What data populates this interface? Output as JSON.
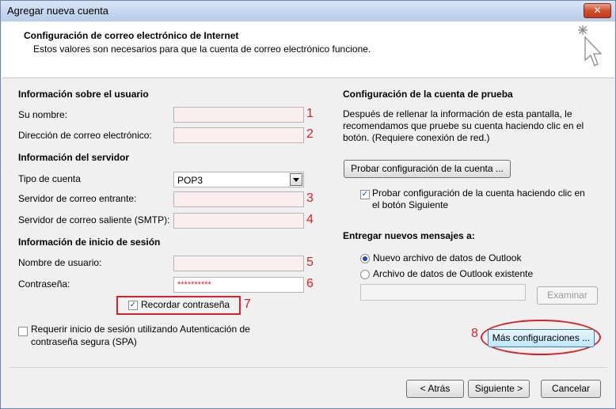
{
  "window": {
    "title": "Agregar nueva cuenta",
    "close_symbol": "✕"
  },
  "header": {
    "title": "Configuración de correo electrónico de Internet",
    "subtitle": "Estos valores son necesarios para que la cuenta de correo electrónico funcione.",
    "icon": "cursor-sparkle-icon"
  },
  "user_info": {
    "section": "Información sobre el usuario",
    "name_label": "Su nombre:",
    "name_value": "",
    "name_marker": "1",
    "email_label": "Dirección de correo electrónico:",
    "email_value": "",
    "email_marker": "2"
  },
  "server_info": {
    "section": "Información del servidor",
    "account_type_label": "Tipo de cuenta",
    "account_type_value": "POP3",
    "incoming_label": "Servidor de correo entrante:",
    "incoming_value": "",
    "incoming_marker": "3",
    "outgoing_label": "Servidor de correo saliente (SMTP):",
    "outgoing_value": "",
    "outgoing_marker": "4"
  },
  "login_info": {
    "section": "Información de inicio de sesión",
    "username_label": "Nombre de usuario:",
    "username_value": "",
    "username_marker": "5",
    "password_label": "Contraseña:",
    "password_value": "**********",
    "password_marker": "6",
    "remember_label": "Recordar contraseña",
    "remember_checked": true,
    "remember_marker": "7",
    "spa_label_line1": "Requerir inicio de sesión utilizando Autenticación de",
    "spa_label_line2": "contraseña segura (SPA)",
    "spa_checked": false
  },
  "test_settings": {
    "section": "Configuración de la cuenta de prueba",
    "description_line1": "Después de rellenar la información de esta pantalla, le",
    "description_line2": "recomendamos que pruebe su cuenta haciendo clic en el",
    "description_line3": "botón. (Requiere conexión de red.)",
    "test_button": "Probar configuración de la cuenta ...",
    "auto_test_line1": "Probar configuración de la cuenta haciendo clic en",
    "auto_test_line2": "el botón Siguiente",
    "auto_test_checked": true
  },
  "delivery": {
    "section": "Entregar nuevos mensajes a:",
    "option_new": "Nuevo archivo de datos de Outlook",
    "option_existing": "Archivo de datos de Outlook existente",
    "selected": "new",
    "path_value": "",
    "browse_button": "Examinar"
  },
  "more_settings": {
    "button": "Más configuraciones ...",
    "marker": "8"
  },
  "footer": {
    "back_button": "< Atrás",
    "next_button": "Siguiente >",
    "cancel_button": "Cancelar"
  },
  "colors": {
    "annotation_red": "#d6232b",
    "field_fill": "#fbeeee",
    "window_bg": "#f0f0f0"
  }
}
